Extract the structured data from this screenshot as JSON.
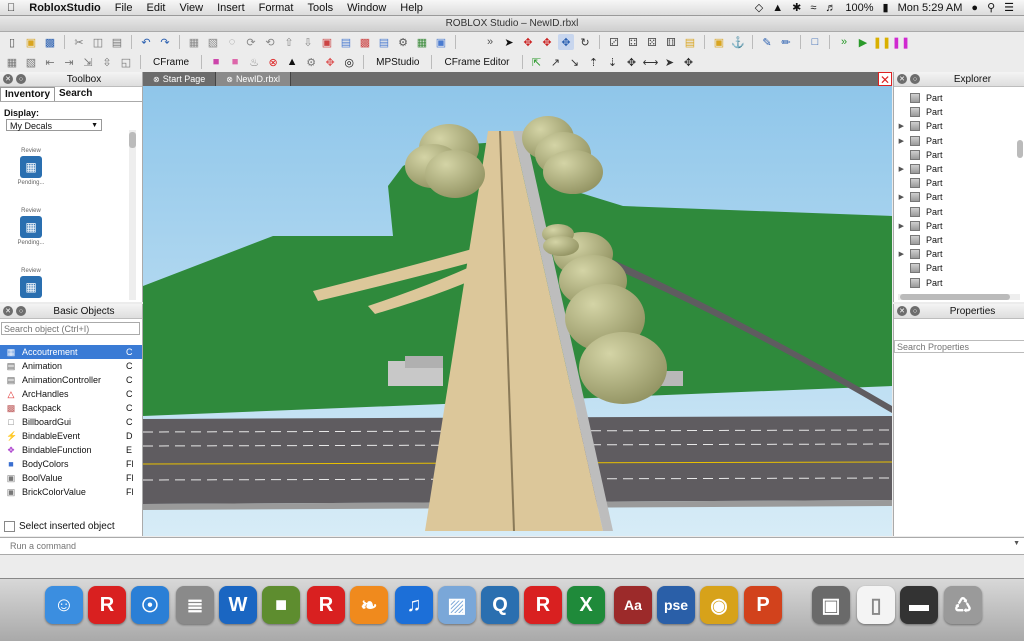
{
  "menubar": {
    "app_name": "RobloxStudio",
    "items": [
      "File",
      "Edit",
      "View",
      "Insert",
      "Format",
      "Tools",
      "Window",
      "Help"
    ],
    "battery": "100%",
    "clock": "Mon 5:29 AM"
  },
  "window": {
    "title": "ROBLOX Studio – NewID.rbxl"
  },
  "toolbar2": {
    "cframe_label": "CFrame",
    "mpstudio_label": "MPStudio",
    "cframe_editor_label": "CFrame Editor"
  },
  "toolbox": {
    "title": "Toolbox",
    "tabs": [
      "Inventory",
      "Search"
    ],
    "display_label": "Display:",
    "display_value": "My Decals",
    "decals": [
      {
        "top": "Review",
        "bottom": "Pending..."
      },
      {
        "top": "Review",
        "bottom": "Pending..."
      },
      {
        "top": "Review",
        "bottom": ""
      }
    ]
  },
  "basic_objects": {
    "title": "Basic Objects",
    "search_placeholder": "Search object (Ctrl+I)",
    "items": [
      "Accoutrement",
      "Animation",
      "AnimationController",
      "ArcHandles",
      "Backpack",
      "BillboardGui",
      "BindableEvent",
      "BindableFunction",
      "BodyColors",
      "BoolValue",
      "BrickColorValue"
    ],
    "right_col": [
      "C",
      "C",
      "C",
      "C",
      "C",
      "C",
      "D",
      "E",
      "Fl",
      "Fl",
      "Fl"
    ],
    "select_inserted_label": "Select inserted object"
  },
  "doc_tabs": [
    "Start Page",
    "NewID.rbxl"
  ],
  "explorer": {
    "title": "Explorer",
    "parts": [
      {
        "label": "Part",
        "expand": false
      },
      {
        "label": "Part",
        "expand": false
      },
      {
        "label": "Part",
        "expand": true
      },
      {
        "label": "Part",
        "expand": true
      },
      {
        "label": "Part",
        "expand": false
      },
      {
        "label": "Part",
        "expand": true
      },
      {
        "label": "Part",
        "expand": false
      },
      {
        "label": "Part",
        "expand": true
      },
      {
        "label": "Part",
        "expand": false
      },
      {
        "label": "Part",
        "expand": true
      },
      {
        "label": "Part",
        "expand": false
      },
      {
        "label": "Part",
        "expand": true
      },
      {
        "label": "Part",
        "expand": false
      },
      {
        "label": "Part",
        "expand": false
      }
    ],
    "expand_glyph": "▶"
  },
  "properties": {
    "title": "Properties",
    "search_placeholder": "Search Properties"
  },
  "command": {
    "placeholder": "Run a command"
  },
  "dock": [
    {
      "name": "finder-icon",
      "glyph": "☺",
      "color": "#3b8ee0"
    },
    {
      "name": "roblox-icon",
      "glyph": "R",
      "color": "#d92020"
    },
    {
      "name": "safari-icon",
      "glyph": "☉",
      "color": "#2a7fd6"
    },
    {
      "name": "file-icon",
      "glyph": "≣",
      "color": "#8a8a8a"
    },
    {
      "name": "word-icon",
      "glyph": "W",
      "color": "#1a66c2"
    },
    {
      "name": "minecraft-icon",
      "glyph": "■",
      "color": "#5e8d2f"
    },
    {
      "name": "roblox-studio-icon",
      "glyph": "R",
      "color": "#d92020"
    },
    {
      "name": "ibooks-icon",
      "glyph": "❧",
      "color": "#f08a1d"
    },
    {
      "name": "itunes-icon",
      "glyph": "♫",
      "color": "#1c6fd8"
    },
    {
      "name": "preview-icon",
      "glyph": "▨",
      "color": "#7aa7d8"
    },
    {
      "name": "quicktime-icon",
      "glyph": "Q",
      "color": "#2a6fb0"
    },
    {
      "name": "roblox-player-icon",
      "glyph": "R",
      "color": "#d92020"
    },
    {
      "name": "excel-icon",
      "glyph": "X",
      "color": "#1f8a3a"
    },
    {
      "name": "dictionary-icon",
      "glyph": "Aa",
      "color": "#9c2a2a"
    },
    {
      "name": "photoshop-elements-icon",
      "glyph": "pse",
      "color": "#2a5fa8"
    },
    {
      "name": "chrome-icon",
      "glyph": "◉",
      "color": "#d7a21a"
    },
    {
      "name": "powerpoint-icon",
      "glyph": "P",
      "color": "#d2421c"
    },
    {
      "name": "preview-thumb-icon",
      "glyph": "▣",
      "color": "#6a6a6a"
    },
    {
      "name": "document-icon",
      "glyph": "▯",
      "color": "#f4f4f4"
    },
    {
      "name": "pse-thumb-icon",
      "glyph": "▬",
      "color": "#333333"
    },
    {
      "name": "trash-icon",
      "glyph": "♺",
      "color": "#9a9a9a"
    }
  ],
  "colors": {
    "sky": "#a9d4ef",
    "grass": "#2f8a3c",
    "road": "#dcc79a",
    "asphalt": "#5f5c60",
    "tree": "#b7b788",
    "selection": "#3a7bd5"
  }
}
